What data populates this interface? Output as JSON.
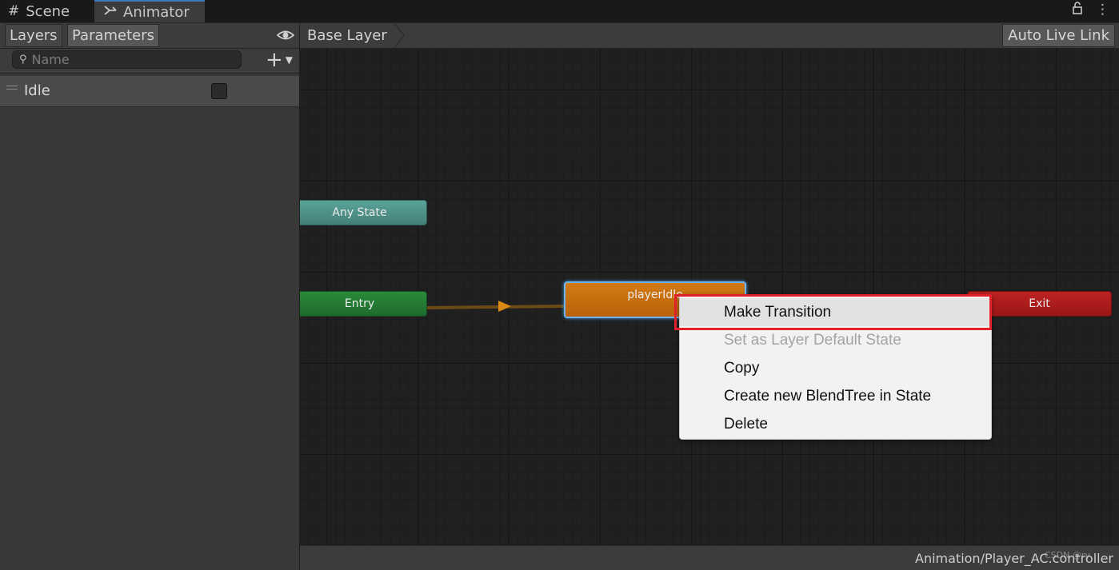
{
  "tabs": [
    {
      "label": "Scene",
      "icon": "grid-icon"
    },
    {
      "label": "Animator",
      "icon": "animator-icon"
    }
  ],
  "left_panel": {
    "tabs": {
      "layers": "Layers",
      "parameters": "Parameters"
    },
    "search": {
      "placeholder": "Name",
      "value": ""
    },
    "parameters": [
      {
        "name": "Idle",
        "type": "bool",
        "checked": false
      }
    ]
  },
  "breadcrumb": {
    "layer": "Base Layer"
  },
  "toolbar": {
    "auto_live_link": "Auto Live Link"
  },
  "graph": {
    "nodes": {
      "any_state": "Any State",
      "entry": "Entry",
      "player_idle": "playerIdle",
      "exit": "Exit"
    }
  },
  "context_menu": {
    "items": [
      {
        "label": "Make Transition",
        "enabled": true,
        "highlighted": true
      },
      {
        "label": "Set as Layer Default State",
        "enabled": false
      },
      {
        "label": "Copy",
        "enabled": true
      },
      {
        "label": "Create new BlendTree in State",
        "enabled": true
      },
      {
        "label": "Delete",
        "enabled": true
      }
    ]
  },
  "status": {
    "path": "Animation/Player_AC.controller",
    "watermark": "CSDN @ry"
  },
  "colors": {
    "any_state": "#5aa399",
    "entry": "#2a8a3a",
    "player_idle": "#d27a12",
    "exit": "#be2222",
    "highlight_box": "#e0202a",
    "selection_outline": "#6eb4f0"
  }
}
